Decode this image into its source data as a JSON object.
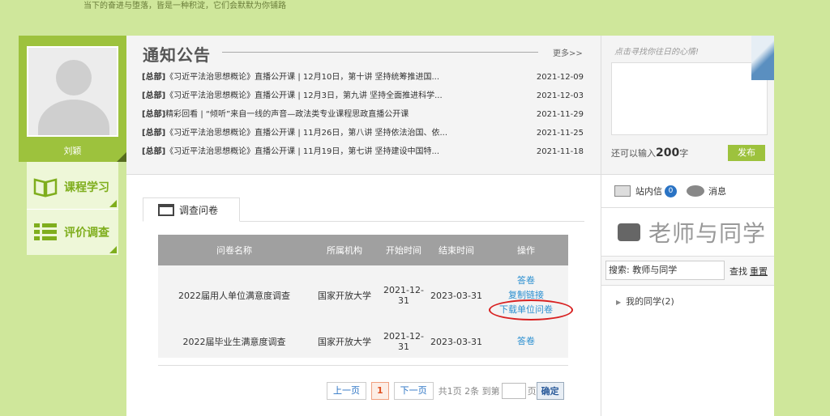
{
  "motto": "当下的奋进与堕落，皆是一种积淀，它们会默默为你铺路",
  "profile": {
    "name": "刘颖"
  },
  "sidebar": {
    "items": [
      {
        "label": "课程学习",
        "icon": "book-icon"
      },
      {
        "label": "评价调查",
        "icon": "list-icon"
      }
    ]
  },
  "notice": {
    "title": "通知公告",
    "more": "更多>>",
    "items": [
      {
        "tag": "[总部]",
        "text": "《习近平法治思想概论》直播公开课 | 12月10日，第十讲 坚持统筹推进国...",
        "date": "2021-12-09"
      },
      {
        "tag": "[总部]",
        "text": "《习近平法治思想概论》直播公开课 | 12月3日，第九讲 坚持全面推进科学...",
        "date": "2021-12-03"
      },
      {
        "tag": "[总部]",
        "text": "精彩回看 | “倾听”来自一线的声音—政法类专业课程思政直播公开课",
        "date": "2021-11-29"
      },
      {
        "tag": "[总部]",
        "text": "《习近平法治思想概论》直播公开课 | 11月26日，第八讲 坚持依法治国、依...",
        "date": "2021-11-25"
      },
      {
        "tag": "[总部]",
        "text": "《习近平法治思想概论》直播公开课 | 11月19日，第七讲 坚持建设中国特...",
        "date": "2021-11-18"
      }
    ]
  },
  "survey": {
    "tab": "调查问卷",
    "headers": {
      "name": "问卷名称",
      "org": "所属机构",
      "start": "开始时间",
      "end": "结束时间",
      "ops": "操作"
    },
    "rows": [
      {
        "name": "2022届用人单位满意度调查",
        "org": "国家开放大学",
        "start": "2021-12-31",
        "end": "2023-03-31",
        "ops": [
          "答卷",
          "复制链接",
          "下载单位问卷"
        ]
      },
      {
        "name": "2022届毕业生满意度调查",
        "org": "国家开放大学",
        "start": "2021-12-31",
        "end": "2023-03-31",
        "ops": [
          "答卷"
        ]
      }
    ]
  },
  "pager": {
    "prev": "上一页",
    "current": "1",
    "next": "下一页",
    "info": "共1页 2条 到第",
    "page_suffix": "页",
    "go": "确定"
  },
  "status": {
    "hint": "点击寻找你往日的心情!",
    "remain_prefix": "还可以输入",
    "remain_count": "200",
    "remain_suffix": "字",
    "publish": "发布"
  },
  "messages": {
    "inbox": "站内信",
    "inbox_count": "0",
    "msg": "消息"
  },
  "friends": {
    "title": "老师与同学",
    "search_value": "搜索: 教师与同学",
    "search_btn": "查找",
    "reset_btn": "重置",
    "group": "我的同学(2)"
  }
}
